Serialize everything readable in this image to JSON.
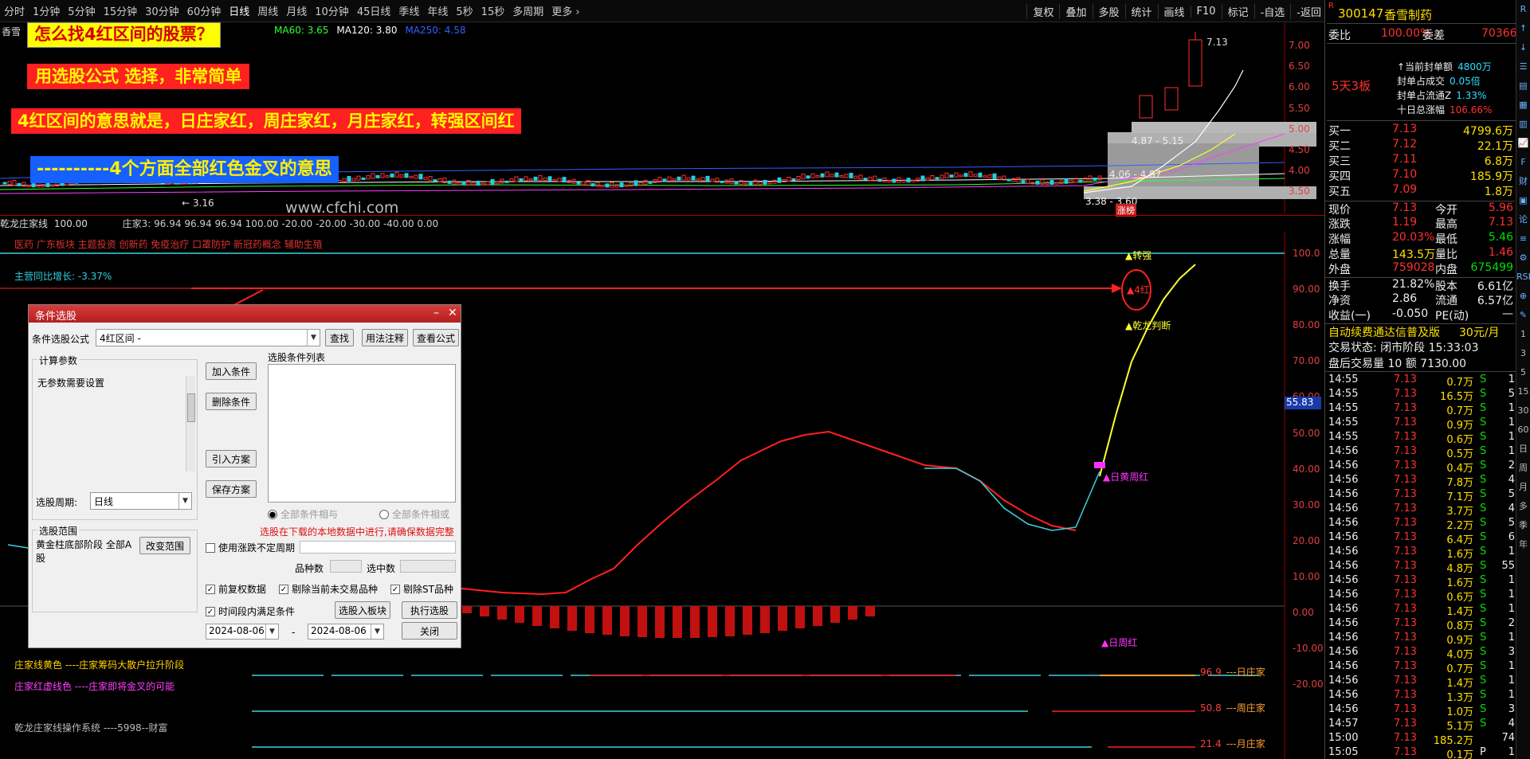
{
  "menu": {
    "periods": [
      "分时",
      "1分钟",
      "5分钟",
      "15分钟",
      "30分钟",
      "60分钟",
      "日线",
      "周线",
      "月线",
      "10分钟",
      "45日线",
      "季线",
      "年线",
      "5秒",
      "15秒",
      "多周期",
      "更多 ›"
    ],
    "active": "日线",
    "tools": [
      "复权",
      "叠加",
      "多股",
      "统计",
      "画线",
      "F10",
      "标记",
      "-自选",
      "-返回"
    ]
  },
  "chart": {
    "stock_short": "香雪",
    "ma_legend": [
      {
        "text": "MA60: 3.65",
        "color": "#30ff30"
      },
      {
        "text": "MA120: 3.80",
        "color": "#ffffff"
      },
      {
        "text": "MA250: 4.58",
        "color": "#3060ff"
      }
    ],
    "price_ticks": [
      "7.00",
      "6.50",
      "6.00",
      "5.50",
      "5.00",
      "4.50",
      "4.00",
      "3.50"
    ],
    "high_label": "7.13",
    "low_label": "3.16",
    "box_labels": [
      "4.87 - 5.15",
      "4.06 - 4.87",
      "3.38 - 3.60"
    ],
    "board_tag": "涨榜",
    "watermark": "www.cfchi.com"
  },
  "banners": {
    "b1": "怎么找4红区间的股票？",
    "b2": "用选股公式  选择，非常简单",
    "b3": "4红区间的意思就是，日庄家红，周庄家红，月庄家红，转强区间红",
    "b4": "----------4个方面全部红色金叉的意思"
  },
  "indicator": {
    "name": "乾龙庄家线",
    "value": "100.00",
    "params": "庄家3: 96.94  96.94  96.94  100.00  -20.00  -20.00  -30.00  -40.00  0.00",
    "concepts": "医药 广东板块 主题投资 创新药 免疫治疗 口罩防护 新冠药概念 辅助生殖",
    "main_growth": "主营同比增长: -3.37%",
    "ticks": [
      "100.0",
      "90.00",
      "80.00",
      "70.00",
      "60.00",
      "50.00",
      "40.00",
      "30.00",
      "20.00",
      "10.00",
      "0.00",
      "-10.00",
      "-20.00"
    ],
    "current_tag": "55.83",
    "labels": {
      "zhuanqiang": "▲转强",
      "sihong": "▲4红",
      "qianlong": "▲乾龙判断",
      "rihuangzhouhong": "▲日黄周红",
      "rizhouhong": "▲日周红"
    },
    "bottom_tags": [
      {
        "v": "96.9",
        "t": "---日庄家"
      },
      {
        "v": "50.8",
        "t": "---周庄家"
      },
      {
        "v": "21.4",
        "t": "---月庄家"
      }
    ],
    "legend_yellow": "庄家线黄色 ----庄家筹码大散户拉升阶段",
    "legend_pink": "庄家红虚线色 ----庄家即将金叉的可能",
    "system": "乾龙庄家线操作系统 ----5998--财富"
  },
  "dialog": {
    "title": "条件选股",
    "formula_label": "条件选股公式",
    "formula_value": "4红区间  -",
    "btn_find": "查找",
    "btn_usage": "用法注释",
    "btn_view": "查看公式",
    "calc_group": "计算参数",
    "calc_text": "无参数需要设置",
    "btn_add": "加入条件",
    "btn_del": "删除条件",
    "btn_import": "引入方案",
    "btn_save": "保存方案",
    "list_label": "选股条件列表",
    "period_label": "选股周期:",
    "period_value": "日线",
    "radio_and": "全部条件相与",
    "radio_or": "全部条件相或",
    "warning": "选股在下载的本地数据中进行,请确保数据完整",
    "use_var": "使用涨跌不定周期",
    "count_label": "品种数",
    "selected_label": "选中数",
    "range_group": "选股范围",
    "range_text": "黄金柱底部阶段 全部A股",
    "btn_range": "改变范围",
    "cb_fq": "前复权数据",
    "cb_notrade": "剔除当前未交易品种",
    "cb_st": "剔除ST品种",
    "cb_time": "时间段内满足条件",
    "btn_toblock": "选股入板块",
    "btn_exec": "执行选股",
    "date_from": "2024-08-06",
    "date_to": "2024-08-06",
    "btn_close": "关闭"
  },
  "quote": {
    "code": "300147",
    "name": "香雪制药",
    "weibi_label": "委比",
    "weibi_value": "100.00%",
    "weicha_label": "委差",
    "weicha_value": "70366",
    "limit_tag": "5天3板",
    "limit_info": [
      {
        "k": "↑当前封单额",
        "v": "4800万"
      },
      {
        "k": "封单占成交",
        "v": "0.05倍"
      },
      {
        "k": "封单占流通Z",
        "v": "1.33%"
      },
      {
        "k": "十日总涨幅",
        "v": "106.66%"
      }
    ],
    "book": [
      {
        "k": "买一",
        "p": "7.13",
        "v": "4799.6万"
      },
      {
        "k": "买二",
        "p": "7.12",
        "v": "22.1万"
      },
      {
        "k": "买三",
        "p": "7.11",
        "v": "6.8万"
      },
      {
        "k": "买四",
        "p": "7.10",
        "v": "185.9万"
      },
      {
        "k": "买五",
        "p": "7.09",
        "v": "1.8万"
      }
    ],
    "stats": [
      {
        "k1": "现价",
        "v1": "7.13",
        "c1": "red",
        "k2": "今开",
        "v2": "5.96",
        "c2": "red"
      },
      {
        "k1": "涨跌",
        "v1": "1.19",
        "c1": "red",
        "k2": "最高",
        "v2": "7.13",
        "c2": "red"
      },
      {
        "k1": "涨幅",
        "v1": "20.03%",
        "c1": "red",
        "k2": "最低",
        "v2": "5.46",
        "c2": "grn"
      },
      {
        "k1": "总量",
        "v1": "143.5万",
        "c1": "yel",
        "k2": "量比",
        "v2": "1.46",
        "c2": "red"
      },
      {
        "k1": "外盘",
        "v1": "759028",
        "c1": "red",
        "k2": "内盘",
        "v2": "675499",
        "c2": "grn"
      }
    ],
    "stats2": [
      {
        "k1": "换手",
        "v1": "21.82%",
        "k2": "股本",
        "v2": "6.61亿"
      },
      {
        "k1": "净资",
        "v1": "2.86",
        "k2": "流通",
        "v2": "6.57亿"
      },
      {
        "k1": "收益(一)",
        "v1": "-0.050",
        "k2": "PE(动)",
        "v2": "—"
      }
    ],
    "ad_text": "自动续费通达信普及版",
    "ad_price": "30元/月",
    "trade_state": "交易状态: 闭市阶段  15:33:03",
    "after_hours": "盘后交易量 10 额 7130.00"
  },
  "ticks": [
    [
      "14:55",
      "7.13",
      "0.7万",
      "S",
      "1"
    ],
    [
      "14:55",
      "7.13",
      "16.5万",
      "S",
      "5"
    ],
    [
      "14:55",
      "7.13",
      "0.7万",
      "S",
      "1"
    ],
    [
      "14:55",
      "7.13",
      "0.9万",
      "S",
      "1"
    ],
    [
      "14:55",
      "7.13",
      "0.6万",
      "S",
      "1"
    ],
    [
      "14:56",
      "7.13",
      "0.5万",
      "S",
      "1"
    ],
    [
      "14:56",
      "7.13",
      "0.4万",
      "S",
      "2"
    ],
    [
      "14:56",
      "7.13",
      "7.8万",
      "S",
      "4"
    ],
    [
      "14:56",
      "7.13",
      "7.1万",
      "S",
      "5"
    ],
    [
      "14:56",
      "7.13",
      "3.7万",
      "S",
      "4"
    ],
    [
      "14:56",
      "7.13",
      "2.2万",
      "S",
      "5"
    ],
    [
      "14:56",
      "7.13",
      "6.4万",
      "S",
      "6"
    ],
    [
      "14:56",
      "7.13",
      "1.6万",
      "S",
      "1"
    ],
    [
      "14:56",
      "7.13",
      "4.8万",
      "S",
      "55"
    ],
    [
      "14:56",
      "7.13",
      "1.6万",
      "S",
      "1"
    ],
    [
      "14:56",
      "7.13",
      "0.6万",
      "S",
      "1"
    ],
    [
      "14:56",
      "7.13",
      "1.4万",
      "S",
      "1"
    ],
    [
      "14:56",
      "7.13",
      "0.8万",
      "S",
      "2"
    ],
    [
      "14:56",
      "7.13",
      "0.9万",
      "S",
      "1"
    ],
    [
      "14:56",
      "7.13",
      "4.0万",
      "S",
      "3"
    ],
    [
      "14:56",
      "7.13",
      "0.7万",
      "S",
      "1"
    ],
    [
      "14:56",
      "7.13",
      "1.4万",
      "S",
      "1"
    ],
    [
      "14:56",
      "7.13",
      "1.3万",
      "S",
      "1"
    ],
    [
      "14:56",
      "7.13",
      "1.0万",
      "S",
      "3"
    ],
    [
      "14:57",
      "7.13",
      "5.1万",
      "S",
      "4"
    ],
    [
      "15:00",
      "7.13",
      "185.2万",
      "",
      "74"
    ],
    [
      "15:05",
      "7.13",
      "0.1万",
      "P",
      "1"
    ]
  ],
  "sidetools": [
    "R",
    "↑",
    "↓",
    "☰",
    "▤",
    "▦",
    "▥",
    "📈",
    "F",
    "财",
    "▣",
    "论",
    "≡",
    "⚙",
    "RSI",
    "⊕",
    "✎",
    "1",
    "3",
    "5",
    "15",
    "30",
    "60",
    "日",
    "周",
    "月",
    "多",
    "季",
    "年"
  ]
}
